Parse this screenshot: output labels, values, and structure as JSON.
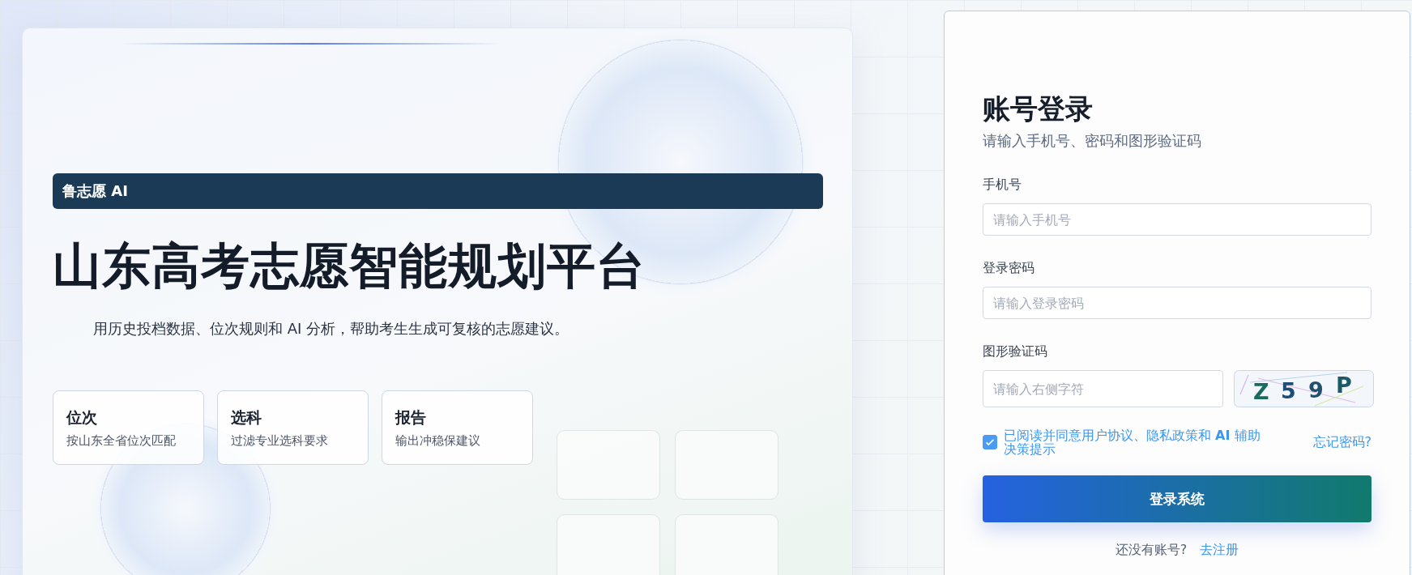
{
  "hero": {
    "brand": "鲁志愿 AI",
    "title": "山东高考志愿智能规划平台",
    "description": "用历史投档数据、位次规则和 AI 分析，帮助考生生成可复核的志愿建议。",
    "features": [
      {
        "title": "位次",
        "text": "按山东全省位次匹配"
      },
      {
        "title": "选科",
        "text": "过滤专业选科要求"
      },
      {
        "title": "报告",
        "text": "输出冲稳保建议"
      }
    ]
  },
  "login": {
    "title": "账号登录",
    "subtitle": "请输入手机号、密码和图形验证码",
    "fields": [
      {
        "label": "手机号",
        "placeholder": "请输入手机号"
      },
      {
        "label": "登录密码",
        "placeholder": "请输入登录密码"
      }
    ],
    "captcha": {
      "label": "图形验证码",
      "placeholder": "请输入右侧字符",
      "characters": [
        "Z",
        "5",
        "9",
        "P"
      ]
    },
    "agree": {
      "checked": true,
      "text": "已阅读并同意用户协议、隐私政策和 **AI** 辅助决策提示"
    },
    "forgot": "忘记密码?",
    "submit": "登录系统",
    "register_prompt": "还没有账号?",
    "register_link": "去注册"
  }
}
